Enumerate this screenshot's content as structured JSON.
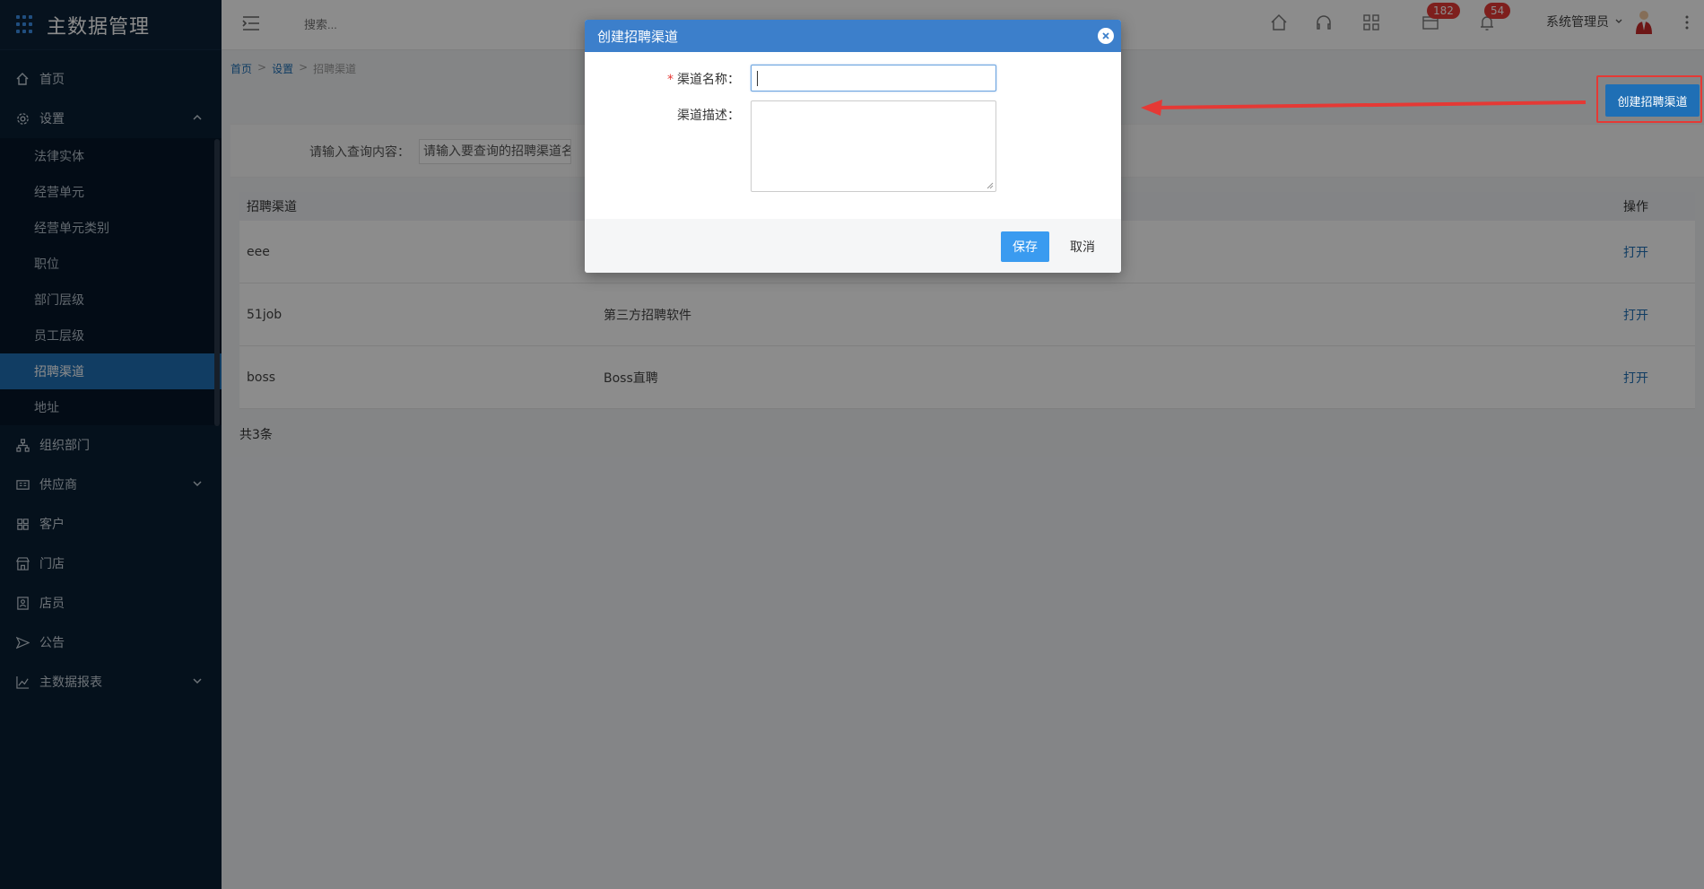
{
  "app": {
    "title": "主数据管理"
  },
  "header": {
    "search_placeholder": "搜索...",
    "badge_messages": "182",
    "badge_notifications": "54",
    "user": "系统管理员"
  },
  "sidebar": {
    "items": [
      {
        "label": "首页"
      },
      {
        "label": "设置"
      },
      {
        "label": "组织部门"
      },
      {
        "label": "供应商"
      },
      {
        "label": "客户"
      },
      {
        "label": "门店"
      },
      {
        "label": "店员"
      },
      {
        "label": "公告"
      },
      {
        "label": "主数据报表"
      }
    ],
    "settings_sub": [
      {
        "label": "法律实体"
      },
      {
        "label": "经营单元"
      },
      {
        "label": "经营单元类别"
      },
      {
        "label": "职位"
      },
      {
        "label": "部门层级"
      },
      {
        "label": "员工层级"
      },
      {
        "label": "招聘渠道"
      },
      {
        "label": "地址"
      }
    ]
  },
  "breadcrumb": {
    "home": "首页",
    "sep": ">",
    "settings": "设置",
    "current": "招聘渠道"
  },
  "main": {
    "create_button": "创建招聘渠道",
    "query_label": "请输入查询内容：",
    "query_placeholder": "请输入要查询的招聘渠道名称",
    "total": "共3条"
  },
  "table": {
    "headers": [
      "招聘渠道",
      "",
      "操作"
    ],
    "rows": [
      {
        "name": "eee",
        "desc": "",
        "action": "打开"
      },
      {
        "name": "51job",
        "desc": "第三方招聘软件",
        "action": "打开"
      },
      {
        "name": "boss",
        "desc": "Boss直聘",
        "action": "打开"
      }
    ]
  },
  "modal": {
    "title": "创建招聘渠道",
    "required_mark": "*",
    "name_label": "渠道名称：",
    "name_value": "",
    "desc_label": "渠道描述：",
    "desc_value": "",
    "save": "保存",
    "cancel": "取消"
  },
  "colors": {
    "sidebar_bg": "#0a1f33",
    "active": "#1f6fb5",
    "modal_header": "#3c7fcb",
    "save_button": "#3a9bf0",
    "badge": "#e53935",
    "annotation": "#e53935"
  }
}
